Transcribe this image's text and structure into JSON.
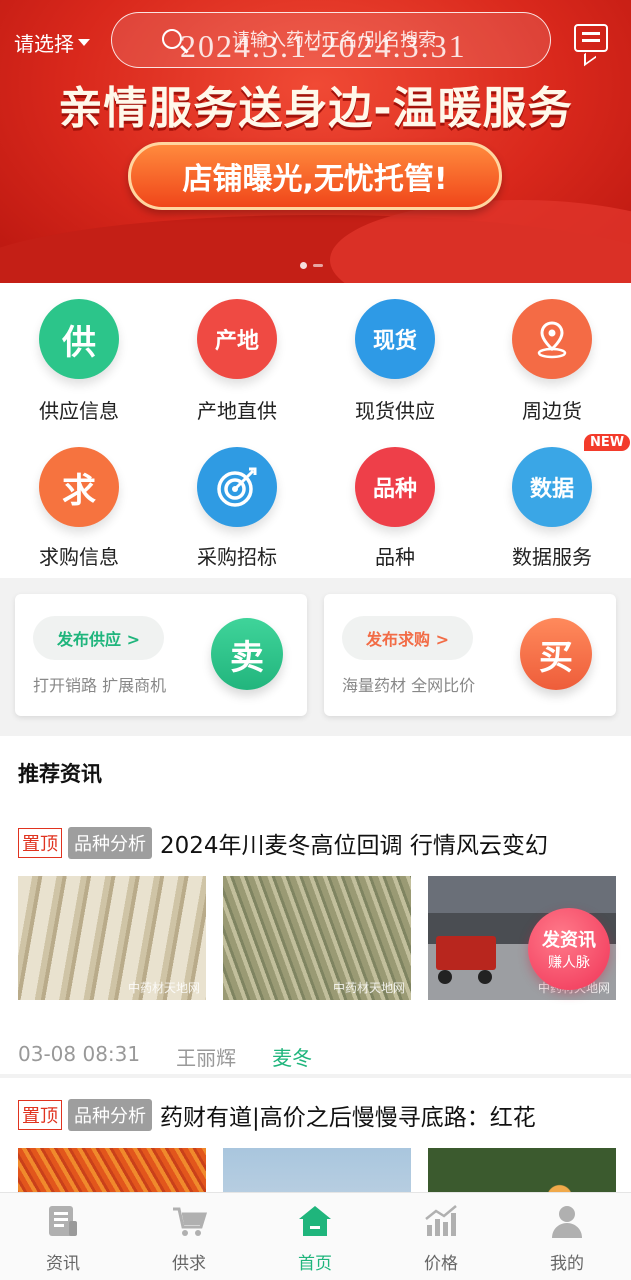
{
  "header": {
    "location_label": "请选择",
    "search_placeholder": "请输入药材正名/别名搜索"
  },
  "banner": {
    "dates": "2024.3.1-2024.3.31",
    "headline": "亲情服务送身边-温暖服务",
    "button_text": "店铺曝光,无忧托管!"
  },
  "categories": [
    {
      "label": "供应信息",
      "glyph": "供",
      "color": "#2cc58a"
    },
    {
      "label": "产地直供",
      "glyph": "产地",
      "color": "#ef4a43"
    },
    {
      "label": "现货供应",
      "glyph": "现货",
      "color": "#2e9ae6"
    },
    {
      "label": "周边货",
      "glyph": "pin",
      "color": "#f46b45"
    },
    {
      "label": "求购信息",
      "glyph": "求",
      "color": "#f6733f"
    },
    {
      "label": "采购招标",
      "glyph": "target",
      "color": "#2f9be3"
    },
    {
      "label": "品种",
      "glyph": "品种",
      "color": "#ee3f49"
    },
    {
      "label": "数据服务",
      "glyph": "数据",
      "color": "#3aa6e6",
      "badge": "NEW"
    }
  ],
  "publish": {
    "supply": {
      "button": "发布供应 >",
      "subtitle": "打开销路 扩展商机",
      "icon_text": "卖",
      "color": "#27c08a"
    },
    "demand": {
      "button": "发布求购 >",
      "subtitle": "海量药材 全网比价",
      "icon_text": "买",
      "color": "#f26c46"
    }
  },
  "news": {
    "section_title": "推荐资讯",
    "articles": [
      {
        "top_tag": "置顶",
        "category": "品种分析",
        "title": "2024年川麦冬高位回调  行情风云变幻",
        "date": "03-08 08:31",
        "author": "王丽辉",
        "keyword": "麦冬",
        "watermark": "中药材天地网"
      },
      {
        "top_tag": "置顶",
        "category": "品种分析",
        "title": "药财有道|高价之后慢慢寻底路：红花"
      }
    ]
  },
  "fab": {
    "line1": "发资讯",
    "line2": "赚人脉"
  },
  "tabs": [
    {
      "label": "资讯",
      "icon": "news-icon",
      "active": false
    },
    {
      "label": "供求",
      "icon": "cart-icon",
      "active": false
    },
    {
      "label": "首页",
      "icon": "home-icon",
      "active": true
    },
    {
      "label": "价格",
      "icon": "chart-icon",
      "active": false
    },
    {
      "label": "我的",
      "icon": "user-icon",
      "active": false
    }
  ],
  "colors": {
    "accent": "#1fb57c",
    "red": "#e0331f"
  }
}
